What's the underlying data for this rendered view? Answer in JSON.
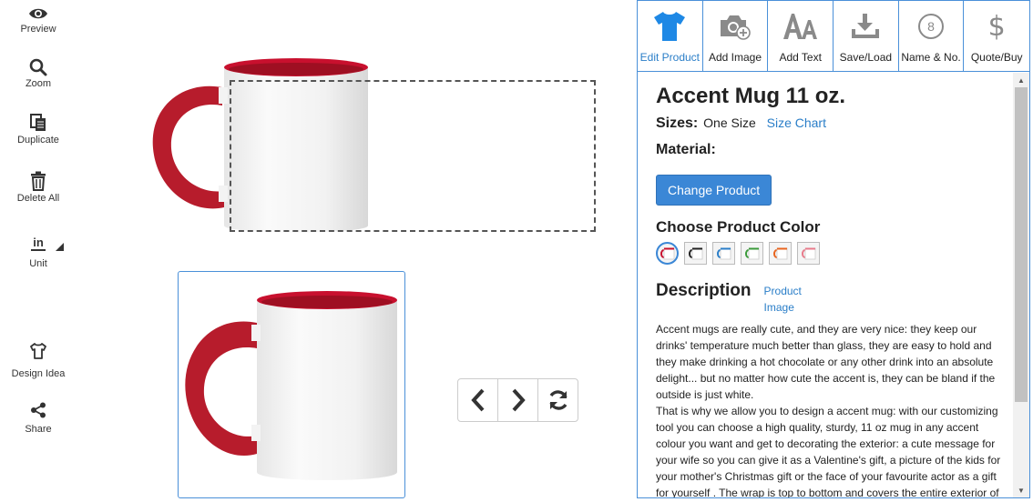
{
  "left_toolbar": {
    "preview": "Preview",
    "zoom": "Zoom",
    "duplicate": "Duplicate",
    "delete_all": "Delete All",
    "unit": "Unit",
    "unit_value": "in",
    "design_idea": "Design Idea",
    "share": "Share"
  },
  "tabs": [
    {
      "label": "Edit Product",
      "icon": "tshirt-icon"
    },
    {
      "label": "Add Image",
      "icon": "camera-plus-icon"
    },
    {
      "label": "Add Text",
      "icon": "text-aa-icon"
    },
    {
      "label": "Save/Load",
      "icon": "download-icon"
    },
    {
      "label": "Name & No.",
      "icon": "number-circle-icon",
      "badge": "8"
    },
    {
      "label": "Quote/Buy",
      "icon": "dollar-icon",
      "symbol": "$"
    }
  ],
  "product": {
    "title": "Accent Mug 11 oz.",
    "sizes_label": "Sizes:",
    "sizes_value": "One Size",
    "size_chart": "Size Chart",
    "material_label": "Material:",
    "change_button": "Change Product",
    "color_heading": "Choose Product Color",
    "colors": [
      "#c8102e",
      "#222222",
      "#2a7ec8",
      "#3a9a3a",
      "#e8641e",
      "#e87a8a"
    ],
    "description_heading": "Description",
    "product_image_link": "Product Image",
    "description_text": "Accent mugs are really cute, and they are very nice: they keep our drinks' temperature much better than glass, they are easy to hold and they make drinking a hot chocolate or any other drink into an absolute delight... but no matter how cute the accent is, they can be bland if the outside is just white.",
    "description_text_2": "That is why we allow you to design a accent mug: with our customizing tool you can choose a high quality, sturdy, 11 oz mug in any accent colour you want and get to decorating the exterior: a cute message for your wife so you can give it as a Valentine's gift, a picture of the kids for your mother's Christmas gift or the face of your favourite actor as a gift for yourself . The wrap is top to bottom and covers the entire exterior of"
  },
  "colors": {
    "accent": "#2a7ec8",
    "mug_red": "#c8102e"
  }
}
